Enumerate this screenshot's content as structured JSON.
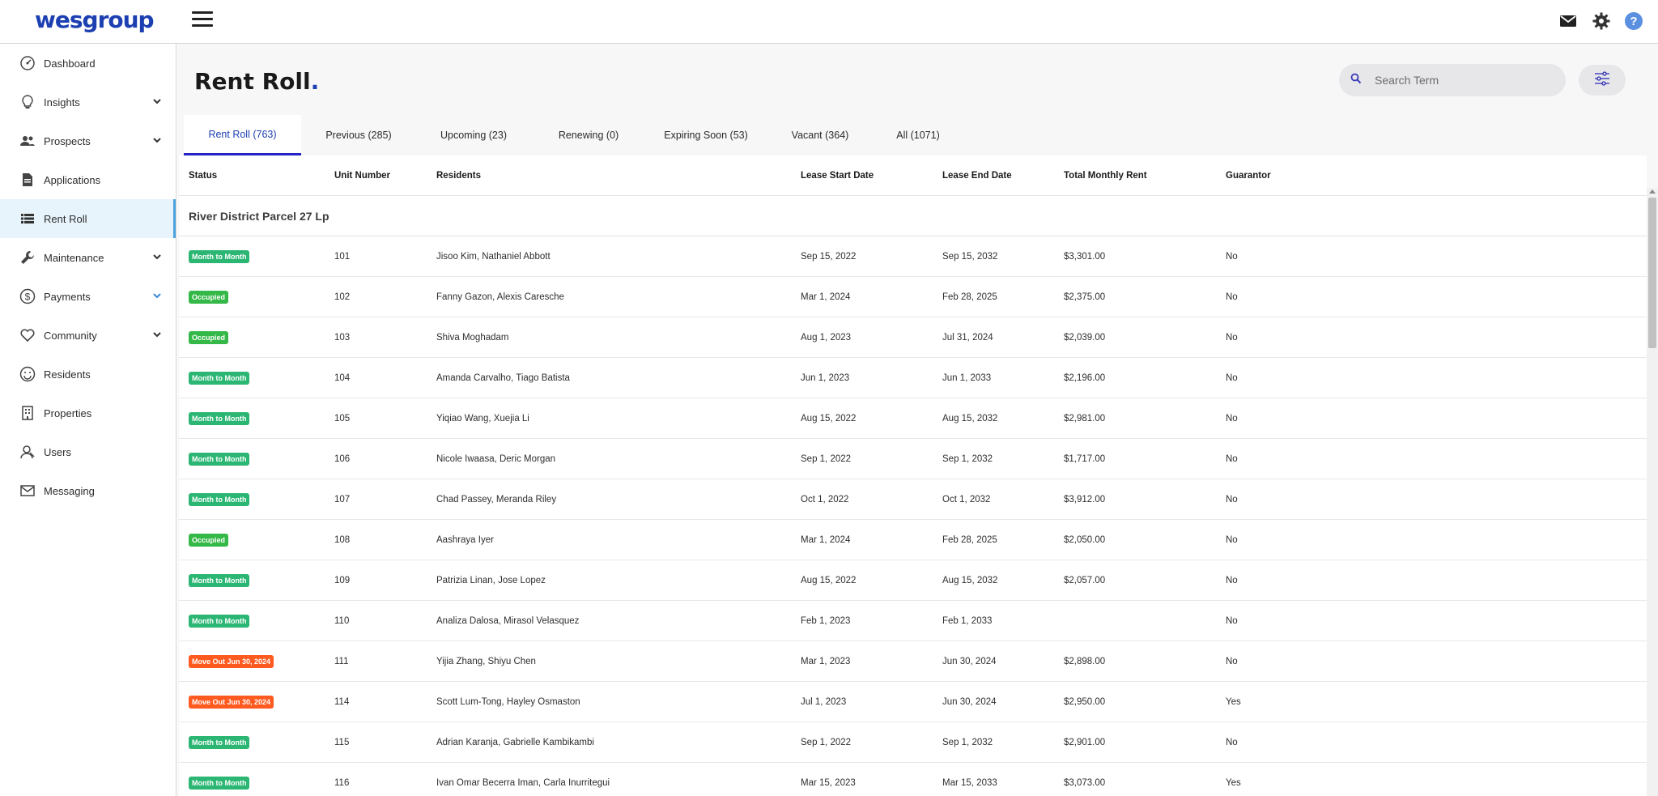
{
  "app": {
    "logo": "wesgroup",
    "page_title": "Rent Roll",
    "page_title_dot": "."
  },
  "header_icons": [
    "menu-icon",
    "mail-icon",
    "gear-icon",
    "help-icon"
  ],
  "colors": {
    "brand": "#1c3fb1",
    "tab_active_underline": "#2323c8",
    "badge_month": "#2bb673",
    "badge_occupied": "#34b847",
    "badge_moveout": "#ff5a1f",
    "sidebar_active_bg": "#e8f4fc",
    "sidebar_active_border": "#4aa3df"
  },
  "sidebar": {
    "items": [
      {
        "label": "Dashboard",
        "icon": "dashboard-icon",
        "expandable": false
      },
      {
        "label": "Insights",
        "icon": "lightbulb-icon",
        "expandable": true
      },
      {
        "label": "Prospects",
        "icon": "people-icon",
        "expandable": true
      },
      {
        "label": "Applications",
        "icon": "document-icon",
        "expandable": false
      },
      {
        "label": "Rent Roll",
        "icon": "list-icon",
        "expandable": false,
        "active": true
      },
      {
        "label": "Maintenance",
        "icon": "wrench-icon",
        "expandable": true
      },
      {
        "label": "Payments",
        "icon": "dollar-icon",
        "expandable": true,
        "chevron_highlight": true
      },
      {
        "label": "Community",
        "icon": "heart-icon",
        "expandable": true
      },
      {
        "label": "Residents",
        "icon": "smiley-icon",
        "expandable": false
      },
      {
        "label": "Properties",
        "icon": "building-icon",
        "expandable": false
      },
      {
        "label": "Users",
        "icon": "users-icon",
        "expandable": false
      },
      {
        "label": "Messaging",
        "icon": "envelope-icon",
        "expandable": false
      }
    ]
  },
  "search": {
    "placeholder": "Search Term",
    "value": ""
  },
  "tabs": [
    {
      "label": "Rent Roll (763)",
      "active": true
    },
    {
      "label": "Previous (285)"
    },
    {
      "label": "Upcoming (23)"
    },
    {
      "label": "Renewing (0)"
    },
    {
      "label": "Expiring Soon (53)"
    },
    {
      "label": "Vacant (364)"
    },
    {
      "label": "All (1071)"
    }
  ],
  "table": {
    "headers": {
      "status": "Status",
      "unit": "Unit Number",
      "residents": "Residents",
      "start": "Lease Start Date",
      "end": "Lease End Date",
      "rent": "Total Monthly Rent",
      "guarantor": "Guarantor"
    },
    "group": "River District Parcel 27 Lp",
    "rows": [
      {
        "status": "Month to Month",
        "type": "month",
        "unit": "101",
        "residents": "Jisoo Kim, Nathaniel Abbott",
        "start": "Sep 15, 2022",
        "end": "Sep 15, 2032",
        "rent": "$3,301.00",
        "guarantor": "No"
      },
      {
        "status": "Occupied",
        "type": "occupied",
        "unit": "102",
        "residents": "Fanny Gazon, Alexis Caresche",
        "start": "Mar 1, 2024",
        "end": "Feb 28, 2025",
        "rent": "$2,375.00",
        "guarantor": "No"
      },
      {
        "status": "Occupied",
        "type": "occupied",
        "unit": "103",
        "residents": "Shiva Moghadam",
        "start": "Aug 1, 2023",
        "end": "Jul 31, 2024",
        "rent": "$2,039.00",
        "guarantor": "No"
      },
      {
        "status": "Month to Month",
        "type": "month",
        "unit": "104",
        "residents": "Amanda Carvalho, Tiago Batista",
        "start": "Jun 1, 2023",
        "end": "Jun 1, 2033",
        "rent": "$2,196.00",
        "guarantor": "No"
      },
      {
        "status": "Month to Month",
        "type": "month",
        "unit": "105",
        "residents": "Yiqiao Wang, Xuejia Li",
        "start": "Aug 15, 2022",
        "end": "Aug 15, 2032",
        "rent": "$2,981.00",
        "guarantor": "No"
      },
      {
        "status": "Month to Month",
        "type": "month",
        "unit": "106",
        "residents": "Nicole Iwaasa, Deric Morgan",
        "start": "Sep 1, 2022",
        "end": "Sep 1, 2032",
        "rent": "$1,717.00",
        "guarantor": "No"
      },
      {
        "status": "Month to Month",
        "type": "month",
        "unit": "107",
        "residents": "Chad Passey, Meranda Riley",
        "start": "Oct 1, 2022",
        "end": "Oct 1, 2032",
        "rent": "$3,912.00",
        "guarantor": "No"
      },
      {
        "status": "Occupied",
        "type": "occupied",
        "unit": "108",
        "residents": "Aashraya Iyer",
        "start": "Mar 1, 2024",
        "end": "Feb 28, 2025",
        "rent": "$2,050.00",
        "guarantor": "No"
      },
      {
        "status": "Month to Month",
        "type": "month",
        "unit": "109",
        "residents": "Patrizia Linan, Jose Lopez",
        "start": "Aug 15, 2022",
        "end": "Aug 15, 2032",
        "rent": "$2,057.00",
        "guarantor": "No"
      },
      {
        "status": "Month to Month",
        "type": "month",
        "unit": "110",
        "residents": "Analiza Dalosa, Mirasol Velasquez",
        "start": "Feb 1, 2023",
        "end": "Feb 1, 2033",
        "rent": "",
        "guarantor": "No"
      },
      {
        "status": "Move Out Jun 30, 2024",
        "type": "moveout",
        "unit": "111",
        "residents": "Yijia Zhang, Shiyu Chen",
        "start": "Mar 1, 2023",
        "end": "Jun 30, 2024",
        "rent": "$2,898.00",
        "guarantor": "No"
      },
      {
        "status": "Move Out Jun 30, 2024",
        "type": "moveout",
        "unit": "114",
        "residents": "Scott Lum-Tong, Hayley Osmaston",
        "start": "Jul 1, 2023",
        "end": "Jun 30, 2024",
        "rent": "$2,950.00",
        "guarantor": "Yes"
      },
      {
        "status": "Month to Month",
        "type": "month",
        "unit": "115",
        "residents": "Adrian Karanja, Gabrielle Kambikambi",
        "start": "Sep 1, 2022",
        "end": "Sep 1, 2032",
        "rent": "$2,901.00",
        "guarantor": "No"
      },
      {
        "status": "Month to Month",
        "type": "month",
        "unit": "116",
        "residents": "Ivan Omar Becerra Iman, Carla Inurritegui",
        "start": "Mar 15, 2023",
        "end": "Mar 15, 2033",
        "rent": "$3,073.00",
        "guarantor": "Yes"
      }
    ]
  }
}
